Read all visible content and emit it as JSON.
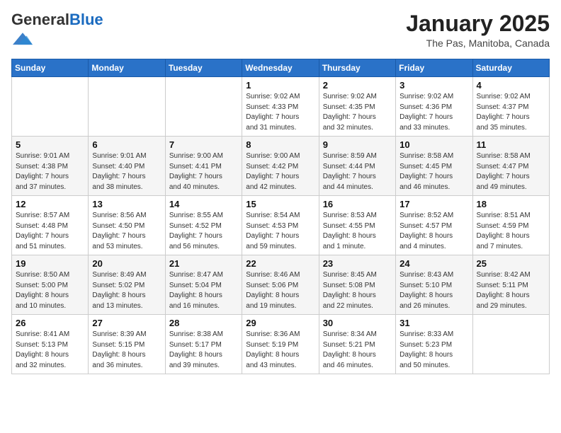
{
  "header": {
    "logo_general": "General",
    "logo_blue": "Blue",
    "month_title": "January 2025",
    "location": "The Pas, Manitoba, Canada"
  },
  "weekdays": [
    "Sunday",
    "Monday",
    "Tuesday",
    "Wednesday",
    "Thursday",
    "Friday",
    "Saturday"
  ],
  "weeks": [
    [
      {
        "day": "",
        "info": ""
      },
      {
        "day": "",
        "info": ""
      },
      {
        "day": "",
        "info": ""
      },
      {
        "day": "1",
        "info": "Sunrise: 9:02 AM\nSunset: 4:33 PM\nDaylight: 7 hours\nand 31 minutes."
      },
      {
        "day": "2",
        "info": "Sunrise: 9:02 AM\nSunset: 4:35 PM\nDaylight: 7 hours\nand 32 minutes."
      },
      {
        "day": "3",
        "info": "Sunrise: 9:02 AM\nSunset: 4:36 PM\nDaylight: 7 hours\nand 33 minutes."
      },
      {
        "day": "4",
        "info": "Sunrise: 9:02 AM\nSunset: 4:37 PM\nDaylight: 7 hours\nand 35 minutes."
      }
    ],
    [
      {
        "day": "5",
        "info": "Sunrise: 9:01 AM\nSunset: 4:38 PM\nDaylight: 7 hours\nand 37 minutes."
      },
      {
        "day": "6",
        "info": "Sunrise: 9:01 AM\nSunset: 4:40 PM\nDaylight: 7 hours\nand 38 minutes."
      },
      {
        "day": "7",
        "info": "Sunrise: 9:00 AM\nSunset: 4:41 PM\nDaylight: 7 hours\nand 40 minutes."
      },
      {
        "day": "8",
        "info": "Sunrise: 9:00 AM\nSunset: 4:42 PM\nDaylight: 7 hours\nand 42 minutes."
      },
      {
        "day": "9",
        "info": "Sunrise: 8:59 AM\nSunset: 4:44 PM\nDaylight: 7 hours\nand 44 minutes."
      },
      {
        "day": "10",
        "info": "Sunrise: 8:58 AM\nSunset: 4:45 PM\nDaylight: 7 hours\nand 46 minutes."
      },
      {
        "day": "11",
        "info": "Sunrise: 8:58 AM\nSunset: 4:47 PM\nDaylight: 7 hours\nand 49 minutes."
      }
    ],
    [
      {
        "day": "12",
        "info": "Sunrise: 8:57 AM\nSunset: 4:48 PM\nDaylight: 7 hours\nand 51 minutes."
      },
      {
        "day": "13",
        "info": "Sunrise: 8:56 AM\nSunset: 4:50 PM\nDaylight: 7 hours\nand 53 minutes."
      },
      {
        "day": "14",
        "info": "Sunrise: 8:55 AM\nSunset: 4:52 PM\nDaylight: 7 hours\nand 56 minutes."
      },
      {
        "day": "15",
        "info": "Sunrise: 8:54 AM\nSunset: 4:53 PM\nDaylight: 7 hours\nand 59 minutes."
      },
      {
        "day": "16",
        "info": "Sunrise: 8:53 AM\nSunset: 4:55 PM\nDaylight: 8 hours\nand 1 minute."
      },
      {
        "day": "17",
        "info": "Sunrise: 8:52 AM\nSunset: 4:57 PM\nDaylight: 8 hours\nand 4 minutes."
      },
      {
        "day": "18",
        "info": "Sunrise: 8:51 AM\nSunset: 4:59 PM\nDaylight: 8 hours\nand 7 minutes."
      }
    ],
    [
      {
        "day": "19",
        "info": "Sunrise: 8:50 AM\nSunset: 5:00 PM\nDaylight: 8 hours\nand 10 minutes."
      },
      {
        "day": "20",
        "info": "Sunrise: 8:49 AM\nSunset: 5:02 PM\nDaylight: 8 hours\nand 13 minutes."
      },
      {
        "day": "21",
        "info": "Sunrise: 8:47 AM\nSunset: 5:04 PM\nDaylight: 8 hours\nand 16 minutes."
      },
      {
        "day": "22",
        "info": "Sunrise: 8:46 AM\nSunset: 5:06 PM\nDaylight: 8 hours\nand 19 minutes."
      },
      {
        "day": "23",
        "info": "Sunrise: 8:45 AM\nSunset: 5:08 PM\nDaylight: 8 hours\nand 22 minutes."
      },
      {
        "day": "24",
        "info": "Sunrise: 8:43 AM\nSunset: 5:10 PM\nDaylight: 8 hours\nand 26 minutes."
      },
      {
        "day": "25",
        "info": "Sunrise: 8:42 AM\nSunset: 5:11 PM\nDaylight: 8 hours\nand 29 minutes."
      }
    ],
    [
      {
        "day": "26",
        "info": "Sunrise: 8:41 AM\nSunset: 5:13 PM\nDaylight: 8 hours\nand 32 minutes."
      },
      {
        "day": "27",
        "info": "Sunrise: 8:39 AM\nSunset: 5:15 PM\nDaylight: 8 hours\nand 36 minutes."
      },
      {
        "day": "28",
        "info": "Sunrise: 8:38 AM\nSunset: 5:17 PM\nDaylight: 8 hours\nand 39 minutes."
      },
      {
        "day": "29",
        "info": "Sunrise: 8:36 AM\nSunset: 5:19 PM\nDaylight: 8 hours\nand 43 minutes."
      },
      {
        "day": "30",
        "info": "Sunrise: 8:34 AM\nSunset: 5:21 PM\nDaylight: 8 hours\nand 46 minutes."
      },
      {
        "day": "31",
        "info": "Sunrise: 8:33 AM\nSunset: 5:23 PM\nDaylight: 8 hours\nand 50 minutes."
      },
      {
        "day": "",
        "info": ""
      }
    ]
  ]
}
